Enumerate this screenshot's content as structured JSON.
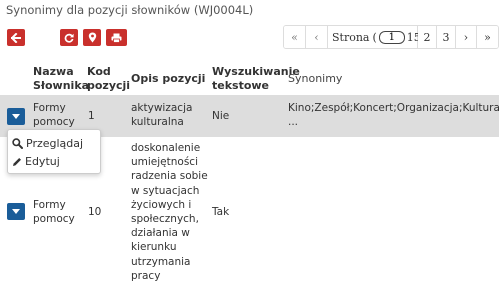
{
  "page": {
    "title": "Synonimy dla pozycji słowników (WJ0004L)"
  },
  "toolbar": {
    "back_icon": "arrow-left-icon",
    "refresh_icon": "refresh-icon",
    "pin_icon": "map-marker-icon",
    "print_icon": "print-icon",
    "button_color": "#c9302c"
  },
  "pagination": {
    "first": "«",
    "prev": "‹",
    "page_label": "Strona",
    "current_page": "1",
    "total": "15)",
    "pages": [
      "2",
      "3"
    ],
    "next": "›",
    "last": "»"
  },
  "table": {
    "headers": {
      "slownik": [
        "Nazwa",
        "Słownika"
      ],
      "kod": [
        "Kod",
        "pozycji"
      ],
      "opis": "Opis pozycji",
      "wyszukiwanie": [
        "Wyszukiwanie",
        "tekstowe"
      ],
      "synonimy": "Synonimy"
    },
    "rows": [
      {
        "slownik": [
          "Formy",
          "pomocy"
        ],
        "kod": "1",
        "opis": [
          "aktywizacja",
          "kulturalna"
        ],
        "wyszukiwanie": "Nie",
        "synonimy": [
          "Kino;Zespół;Koncert;Organizacja;Kultura;Kino;Zes",
          "..."
        ]
      },
      {
        "slownik": [
          "Formy",
          "pomocy"
        ],
        "kod": "10",
        "opis": [
          "doskonalenie",
          "umiejętności",
          "radzenia sobie",
          "w sytuacjach",
          "życiowych i",
          "społecznych,",
          "działania w",
          "kierunku",
          "utrzymania",
          "pracy"
        ],
        "wyszukiwanie": "Tak",
        "synonimy": [
          ""
        ]
      }
    ],
    "highlight_color": "#dddddd",
    "action_button_color": "#1a5d99"
  },
  "row_menu": {
    "items": [
      {
        "label": "Przeglądaj",
        "icon": "search-icon"
      },
      {
        "label": "Edytuj",
        "icon": "pencil-icon"
      }
    ]
  }
}
